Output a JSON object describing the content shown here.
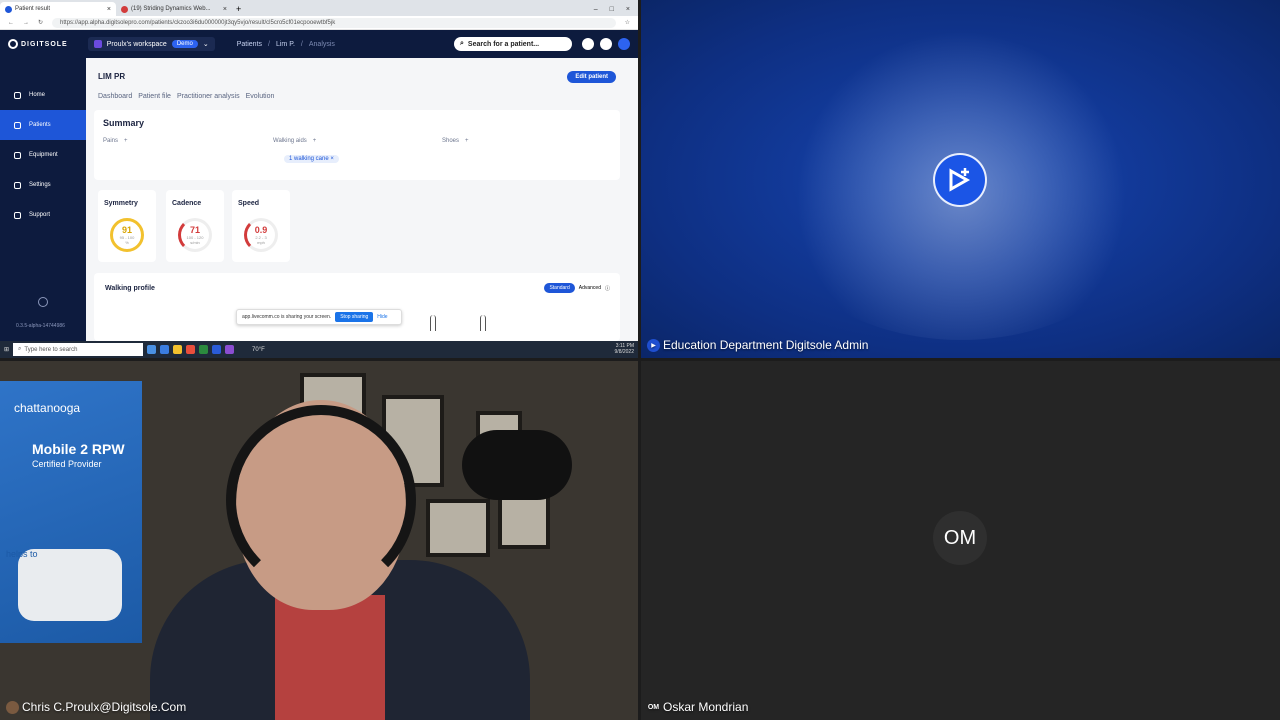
{
  "share": {
    "browser_tabs": [
      {
        "label": "Patient result"
      },
      {
        "label": "(19) Striding Dynamics Web..."
      }
    ],
    "url": "https://app.alpha.digitsolepro.com/patients/ckzoo3i6du000000jt3qy5vjo/result/cl5cro5cf01ecpooewtbf5jk",
    "app": {
      "logo": "DIGITSOLE",
      "workspace": "Proulx's workspace",
      "demo_badge": "Demo",
      "breadcrumb": [
        "Patients",
        "Lim P.",
        "Analysis"
      ],
      "search_label": "Search for a patient...",
      "nav": [
        "Home",
        "Patients",
        "Equipment",
        "Settings",
        "Support"
      ],
      "version": "0.3.5-alpha-14744986"
    },
    "patient": {
      "name": "LIM PR",
      "edit_label": "Edit patient",
      "tabs": [
        "Dashboard",
        "Patient file",
        "Practitioner analysis",
        "Evolution"
      ],
      "summary_title": "Summary",
      "pains_label": "Pains",
      "walking_aids_label": "Walking aids",
      "shoes_label": "Shoes",
      "chip": "1 walking cane"
    },
    "metrics": [
      {
        "label": "Symmetry",
        "value": "91",
        "range": "95 - 100",
        "unit": "%"
      },
      {
        "label": "Cadence",
        "value": "71",
        "range": "100 - 120",
        "unit": "s/min"
      },
      {
        "label": "Speed",
        "value": "0.9",
        "range": "2.2 - 3",
        "unit": "mph"
      }
    ],
    "walking_profile": {
      "title": "Walking profile",
      "standard": "Standard",
      "advanced": "Advanced"
    },
    "sharing_bar": {
      "text": "app.livecomm.co is sharing your screen.",
      "stop": "Stop sharing",
      "hide": "Hide"
    },
    "taskbar": {
      "search_placeholder": "Type here to search",
      "temp": "70°F",
      "time": "3:11 PM",
      "date": "9/8/2022"
    }
  },
  "participants": {
    "education": {
      "name": "Education Department Digitsole Admin"
    },
    "chris": {
      "name": "Chris C.Proulx@Digitsole.Com"
    },
    "oskar": {
      "name": "Oskar Mondrian",
      "initials": "OM"
    }
  },
  "poster": {
    "line1": "chattanooga",
    "line2": "Mobile 2 RPW",
    "line3": "Certified Provider",
    "line4": "helps to"
  }
}
